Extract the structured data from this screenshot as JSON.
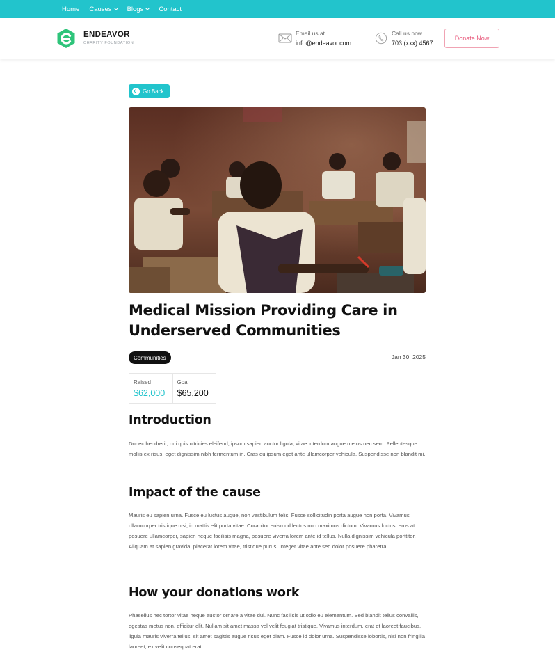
{
  "nav": {
    "items": [
      {
        "label": "Home",
        "dropdown": false
      },
      {
        "label": "Causes",
        "dropdown": true
      },
      {
        "label": "Blogs",
        "dropdown": true
      },
      {
        "label": "Contact",
        "dropdown": false
      }
    ]
  },
  "header": {
    "brand_name": "ENDEAVOR",
    "brand_sub": "CHARITY FOUNDATION",
    "email_label": "Email us at",
    "email_value": "info@endeavor.com",
    "phone_label": "Call us now",
    "phone_value": "703 (xxx) 4567",
    "donate_label": "Donate Now"
  },
  "content": {
    "go_back": "Go Back",
    "title": "Medical Mission Providing Care in Underserved Communities",
    "tag": "Communities",
    "date": "Jan 30, 2025",
    "raised_label": "Raised",
    "raised_value": "$62,000",
    "goal_label": "Goal",
    "goal_value": "$65,200",
    "sections": [
      {
        "heading": "Introduction",
        "body": "Donec hendrerit, dui quis ultricies eleifend, ipsum sapien auctor ligula, vitae interdum augue metus nec sem. Pellentesque mollis ex risus, eget dignissim nibh fermentum in. Cras eu ipsum eget ante ullamcorper vehicula. Suspendisse non blandit mi."
      },
      {
        "heading": "Impact of the cause",
        "body": "Mauris eu sapien urna. Fusce eu luctus augue, non vestibulum felis. Fusce sollicitudin porta augue non porta. Vivamus ullamcorper tristique nisi, in mattis elit porta vitae. Curabitur euismod lectus non maximus dictum. Vivamus luctus, eros at posuere ullamcorper, sapien neque facilisis magna, posuere viverra lorem ante id tellus. Nulla dignissim vehicula porttitor. Aliquam at sapien gravida, placerat lorem vitae, tristique purus. Integer vitae ante sed dolor posuere pharetra."
      },
      {
        "heading": "How your donations work",
        "body": "Phasellus nec tortor vitae neque auctor ornare a vitae dui. Nunc facilisis ut odio eu elementum. Sed blandit tellus convallis, egestas metus non, efficitur elit. Nullam sit amet massa vel velit feugiat tristique. Vivamus interdum, erat et laoreet faucibus, ligula mauris viverra tellus, sit amet sagittis augue risus eget diam. Fusce id dolor urna. Suspendisse lobortis, nisi non fringilla laoreet, ex velit consequat erat."
      }
    ]
  },
  "colors": {
    "accent": "#22c4cc",
    "donate": "#e8577a",
    "logo_green": "#2ec47a"
  },
  "icons": [
    "logo-mark",
    "envelope-icon",
    "phone-icon",
    "arrow-left-icon",
    "chevron-down-icon"
  ]
}
